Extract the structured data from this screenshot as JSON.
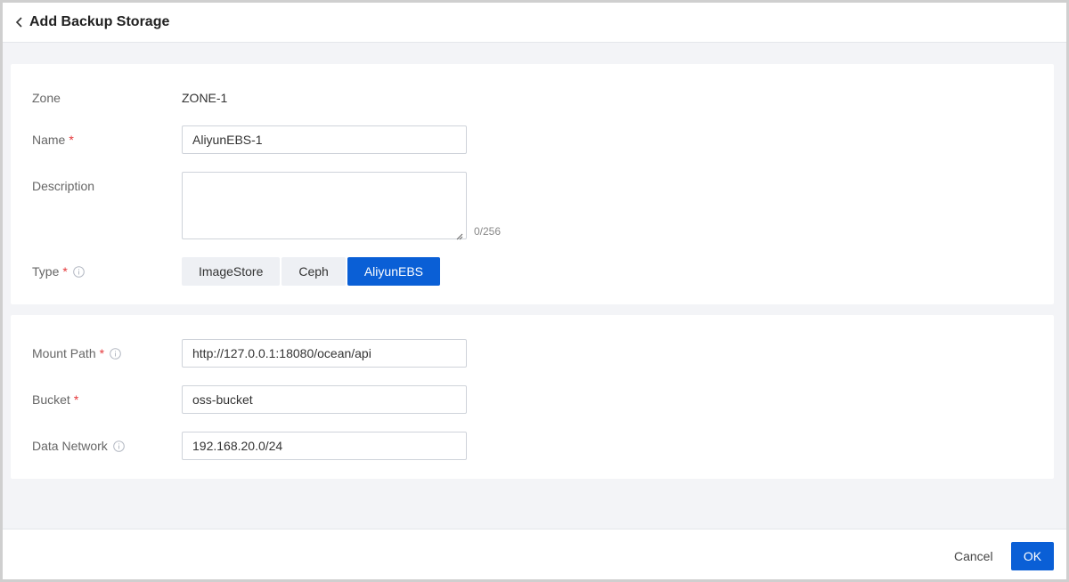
{
  "header": {
    "title": "Add Backup Storage"
  },
  "form": {
    "zone": {
      "label": "Zone",
      "value": "ZONE-1"
    },
    "name": {
      "label": "Name",
      "required": "*",
      "value": "AliyunEBS-1"
    },
    "description": {
      "label": "Description",
      "value": "",
      "counter": "0/256"
    },
    "type": {
      "label": "Type",
      "required": "*",
      "options": [
        "ImageStore",
        "Ceph",
        "AliyunEBS"
      ],
      "selected": "AliyunEBS"
    },
    "mount_path": {
      "label": "Mount Path",
      "required": "*",
      "value": "http://127.0.0.1:18080/ocean/api"
    },
    "bucket": {
      "label": "Bucket",
      "required": "*",
      "value": "oss-bucket"
    },
    "data_network": {
      "label": "Data Network",
      "value": "192.168.20.0/24"
    }
  },
  "footer": {
    "cancel_label": "Cancel",
    "ok_label": "OK"
  },
  "colors": {
    "primary": "#0a5fd6",
    "required": "#e5383b",
    "background": "#f3f4f7"
  },
  "icons": {
    "back": "chevron-left-icon",
    "info": "info-circle-icon",
    "resize": "resize-handle-icon"
  }
}
